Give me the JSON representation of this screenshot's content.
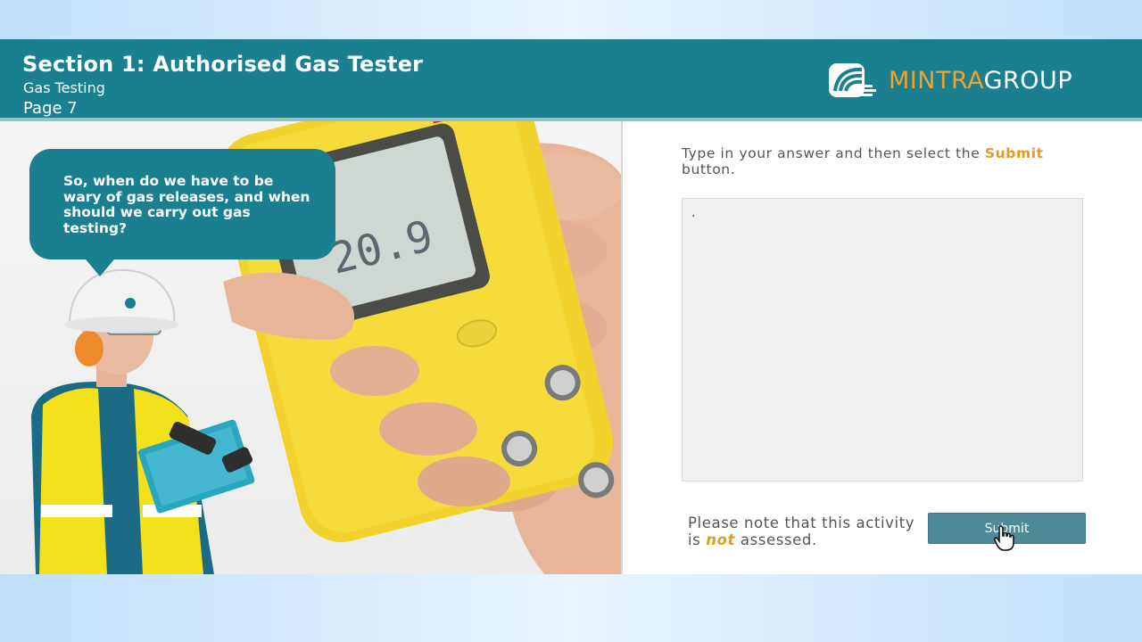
{
  "header": {
    "title": "Section 1: Authorised Gas Tester",
    "subtitle": "Gas Testing",
    "page": "Page 7",
    "logo": {
      "brand_a": "MINTRA",
      "brand_b": "GROUP"
    }
  },
  "speech": {
    "text": "So, when do we have to be wary of gas releases, and when should we carry out gas testing?"
  },
  "device": {
    "display_value": "20.9"
  },
  "activity": {
    "instruction_before": "Type in your answer and then select the",
    "instruction_highlight": "Submit",
    "instruction_after": "button.",
    "answer_value": ".",
    "note_before": "Please note that this activity is",
    "note_emphasis": "not",
    "note_after": "assessed.",
    "submit_label": "Submit"
  },
  "colors": {
    "header_teal": "#1a8090",
    "accent_orange": "#e39b21",
    "button": "#4f8a98"
  },
  "icons": [
    "mintra-logo-icon",
    "hand-pointer-cursor-icon"
  ]
}
